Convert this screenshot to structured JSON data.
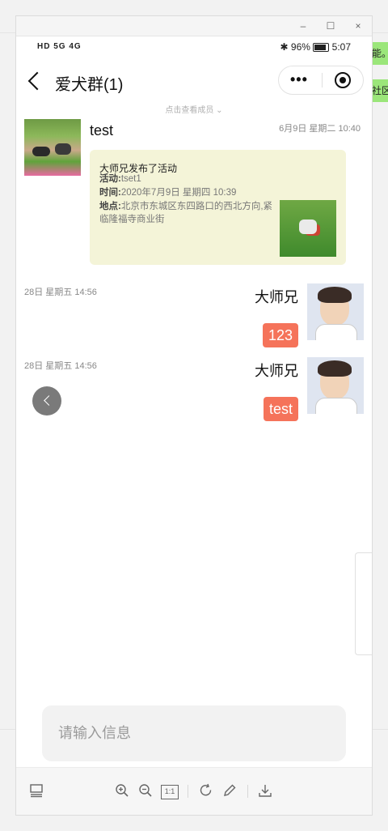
{
  "window": {
    "controls": {
      "minimize": "–",
      "maximize": "☐",
      "close": "×"
    }
  },
  "side_labels": {
    "top": "能。",
    "bottom": "社区"
  },
  "status_bar": {
    "left_indicators": "HD 5G 4G",
    "bluetooth": "✱",
    "battery_percent": "96%",
    "time": "5:07"
  },
  "nav": {
    "title": "爱犬群(1)",
    "more": "•••"
  },
  "members_hint": "点击查看成员 ⌄",
  "messages": [
    {
      "sender": "test",
      "time": "6月9日 星期二 10:40",
      "card": {
        "title": "大师兄发布了活动",
        "activity_label": "活动:",
        "activity_value": "tset1",
        "time_label": "时间:",
        "time_value": "2020年7月9日 星期四 10:39",
        "location_label": "地点:",
        "location_value": "北京市东城区东四路口的西北方向,紧临隆福寺商业街"
      }
    },
    {
      "sender": "大师兄",
      "time": "28日 星期五 14:56",
      "text": "123"
    },
    {
      "sender": "大师兄",
      "time": "28日 星期五 14:56",
      "text": "test"
    }
  ],
  "input": {
    "placeholder": "请输入信息"
  },
  "toolbar": {
    "items": [
      "layout",
      "zoom-in",
      "zoom-out",
      "actual-size",
      "rotate",
      "edit",
      "download"
    ],
    "actual_size_label": "1:1"
  },
  "colors": {
    "bubble": "#f5735a",
    "card_bg": "#f4f4d8",
    "input_bg": "#f2f2f2"
  }
}
